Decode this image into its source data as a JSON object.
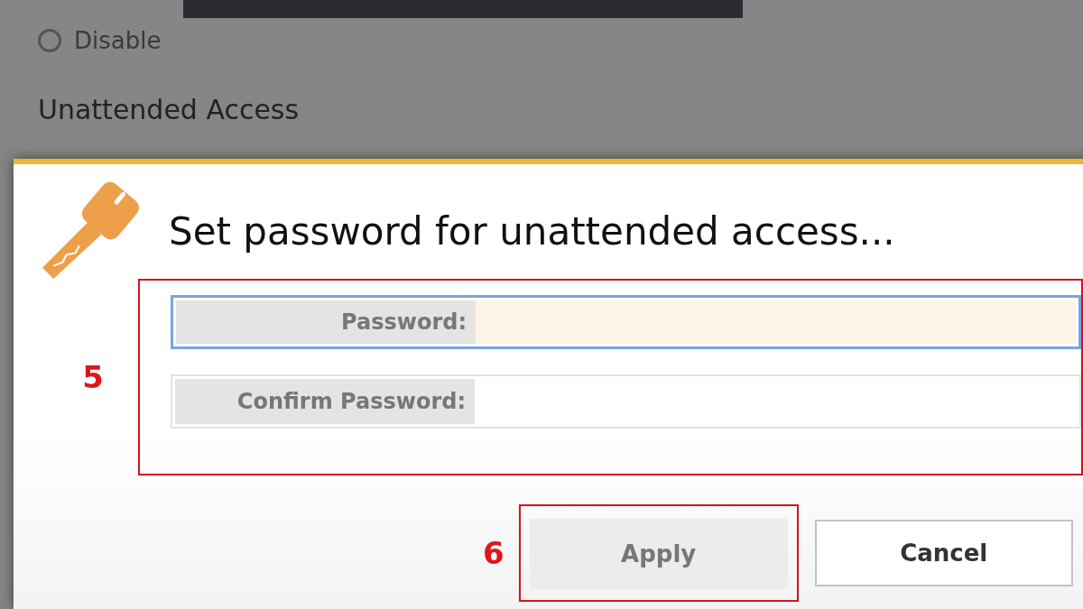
{
  "background": {
    "radio_options": [
      {
        "label": "Disable",
        "selected": false
      }
    ],
    "section_heading": "Unattended Access"
  },
  "dialog": {
    "title": "Set password for unattended access...",
    "fields_marker": "5",
    "fields": [
      {
        "label": "Password:",
        "focused": true
      },
      {
        "label": "Confirm Password:",
        "focused": false
      }
    ],
    "buttons": [
      {
        "label": "Apply",
        "disabled": true,
        "marker": "6"
      },
      {
        "label": "Cancel",
        "disabled": false
      }
    ]
  }
}
